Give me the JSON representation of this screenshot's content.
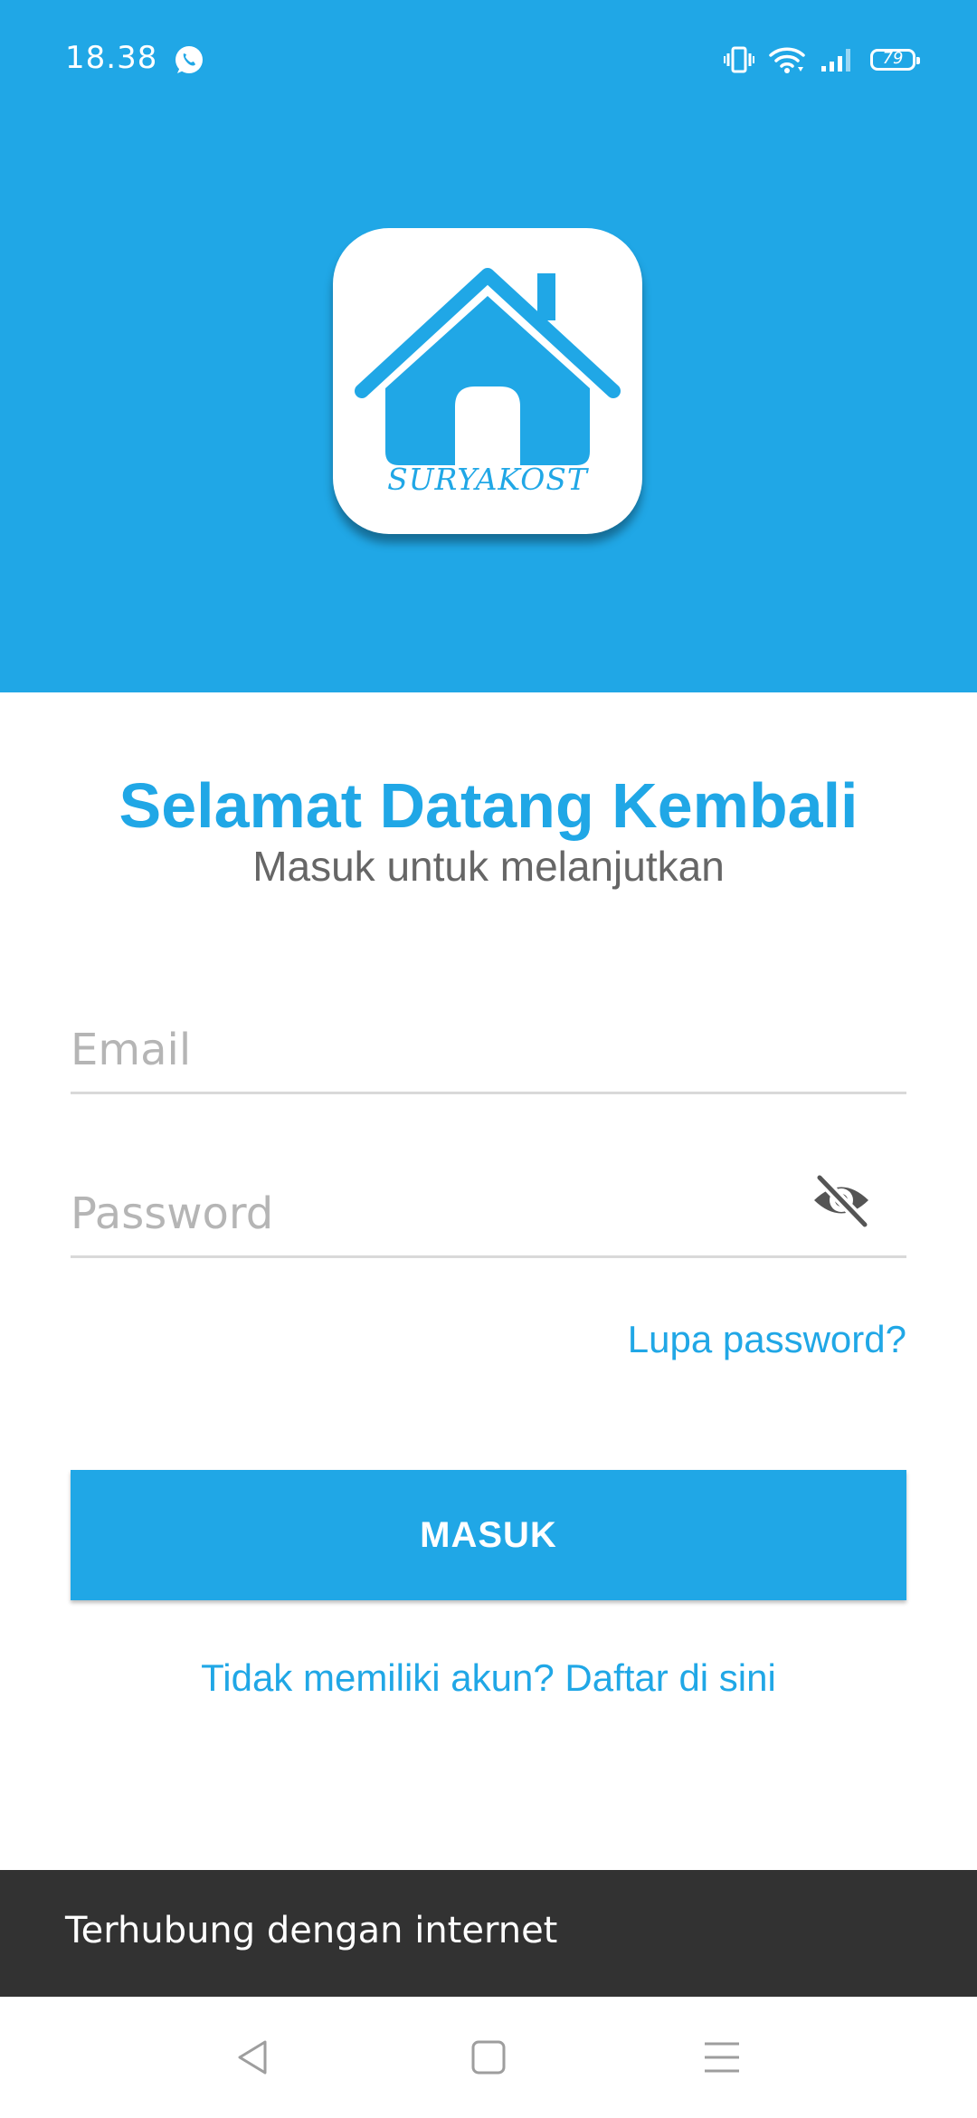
{
  "status_bar": {
    "time": "18.38",
    "battery": "79",
    "icons": [
      "whatsapp-icon",
      "vibrate-icon",
      "wifi-icon",
      "signal-icon",
      "battery-icon"
    ]
  },
  "logo": {
    "text": "SURYAKOST",
    "icon": "house-icon"
  },
  "welcome": {
    "title": "Selamat Datang Kembali",
    "subtitle": "Masuk untuk melanjutkan"
  },
  "form": {
    "email_placeholder": "Email",
    "email_value": "",
    "password_placeholder": "Password",
    "password_value": "",
    "password_toggle_icon": "eye-off-icon",
    "forgot_password": "Lupa password?",
    "submit_label": "MASUK",
    "register_link": "Tidak memiliki akun? Daftar di sini"
  },
  "snackbar": {
    "message": "Terhubung dengan internet"
  },
  "nav_bar": {
    "icons": [
      "back-icon",
      "home-icon",
      "menu-icon"
    ]
  },
  "colors": {
    "primary": "#20a7e6",
    "subtitle": "#666666",
    "snackbar_bg": "#323232"
  }
}
